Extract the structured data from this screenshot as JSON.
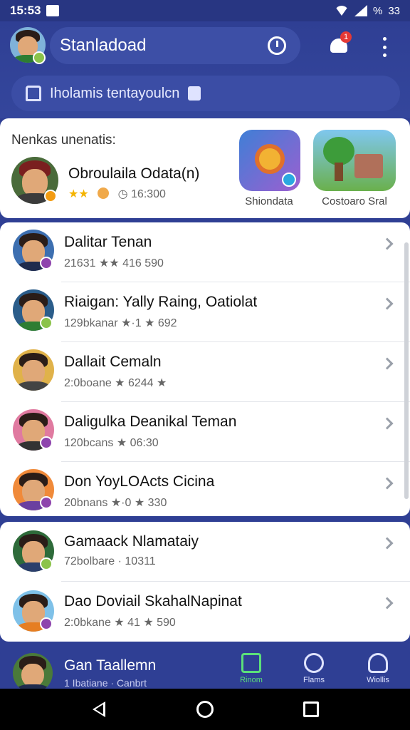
{
  "status": {
    "time": "15:53",
    "right_text": "%",
    "battery": "33"
  },
  "header": {
    "title": "Stanladoad",
    "notification_count": "1",
    "search_text": "Iholamis tentayoulcn"
  },
  "featured": {
    "section_title": "Nenkas unenatis:",
    "name": "Obroulaila Odata(n)",
    "meta": "16:300",
    "apps": [
      {
        "label": "Shiondata"
      },
      {
        "label": "Costoaro Sral"
      }
    ]
  },
  "contacts": [
    {
      "name": "Dalitar Tenan",
      "meta": "21631 ★★ 416 590"
    },
    {
      "name": "Riaigan: Yally Raing, Oatiolat",
      "meta": "129bkanar ★·1 ★ 692"
    },
    {
      "name": "Dallait Cemaln",
      "meta": "2:0boane ★ 6244 ★"
    },
    {
      "name": "Daligulka Deanikal Teman",
      "meta": "120bcans ★ 06:30"
    },
    {
      "name": "Don YoyLOActs Cicina",
      "meta": "20bnans ★·0 ★ 330"
    },
    {
      "name": "Gamaack Nlamataiy",
      "meta": "72bolbare · 10311"
    },
    {
      "name": "Dao Doviail SkahalNapinat",
      "meta": "2:0bkane ★ 41 ★ 590"
    }
  ],
  "bottom": {
    "name": "Gan Taallemn",
    "meta": "1 Ibatiane · Canbrt",
    "nav": [
      {
        "label": "Rinom",
        "icon": "puzzle-icon",
        "active": true
      },
      {
        "label": "Flams",
        "icon": "minus-circle-icon",
        "active": false
      },
      {
        "label": "Wiollis",
        "icon": "person-icon",
        "active": false
      }
    ]
  },
  "colors": {
    "primary": "#2f3f94",
    "accent": "#5be07a",
    "badge": "#e53935"
  }
}
